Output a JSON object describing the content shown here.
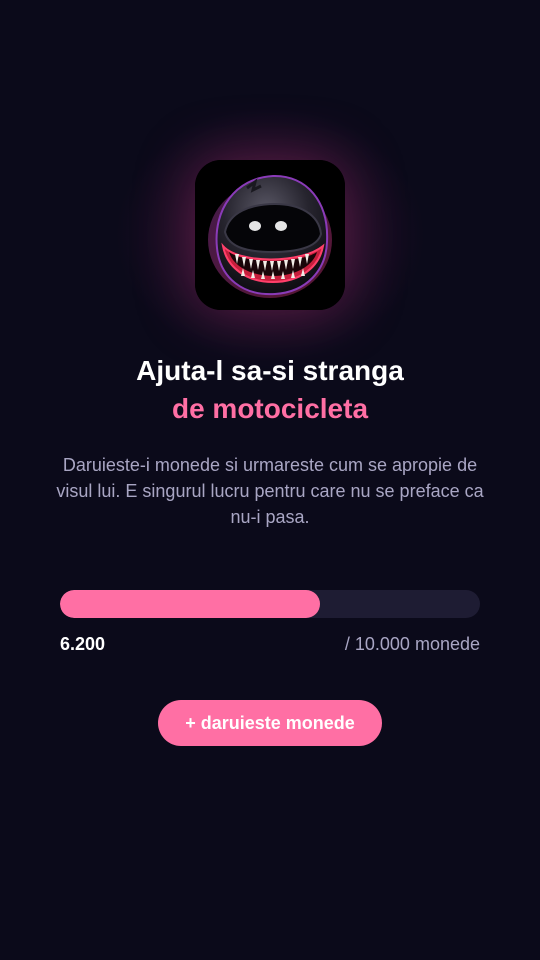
{
  "header": {
    "avatar_icon": "helmet-monster-icon",
    "title_line1": "Ajuta-l sa-si stranga",
    "title_line2": "de motocicleta"
  },
  "description": "Daruieste-i monede si urmareste cum se apropie de visul lui. E singurul lucru pentru care nu se preface ca nu-i pasa.",
  "progress": {
    "current": 6200,
    "goal": 10000,
    "current_label": "6.200",
    "goal_label": "/ 10.000 monede"
  },
  "cta": {
    "label": "+ daruieste monede"
  },
  "colors": {
    "background": "#0b0a1a",
    "accent": "#ff6fa4",
    "track": "#1e1c33",
    "muted_text": "#a9a6c4"
  }
}
